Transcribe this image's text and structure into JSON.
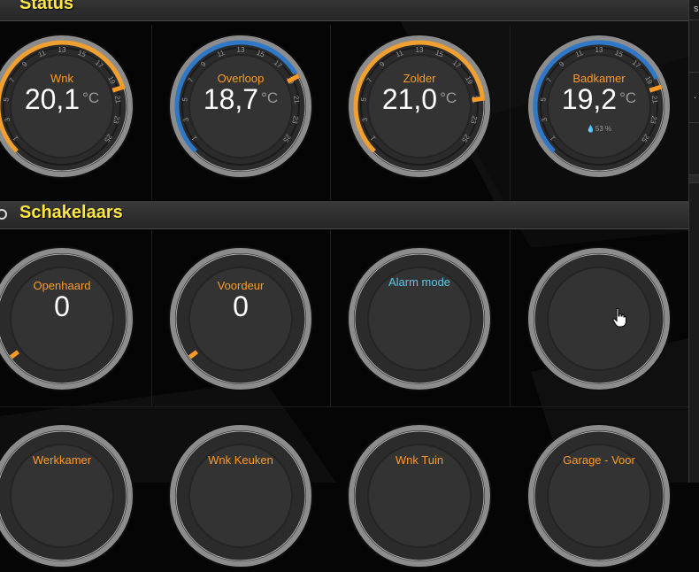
{
  "sections": {
    "status": {
      "title": "Status"
    },
    "switches": {
      "title": "Schakelaars"
    }
  },
  "thermostats": [
    {
      "label": "Wnk",
      "value": "20,1",
      "unit": "°C",
      "accent": "#f0a030",
      "setpoint": 20,
      "humidity": ""
    },
    {
      "label": "Overloop",
      "value": "18,7",
      "unit": "°C",
      "accent": "#2f78c8",
      "setpoint": 19,
      "humidity": ""
    },
    {
      "label": "Zolder",
      "value": "21,0",
      "unit": "°C",
      "accent": "#f0a030",
      "setpoint": 21,
      "humidity": ""
    },
    {
      "label": "Badkamer",
      "value": "19,2",
      "unit": "°C",
      "accent": "#2f78c8",
      "setpoint": 20,
      "humidity": "53 %"
    }
  ],
  "scale_ticks": [
    "1",
    "3",
    "5",
    "7",
    "9",
    "11",
    "13",
    "15",
    "17",
    "19",
    "21",
    "23",
    "25"
  ],
  "switches": [
    {
      "label": "Openhaard",
      "value": "0"
    },
    {
      "label": "Voordeur",
      "value": "0"
    },
    {
      "label": "Alarm mode",
      "value": ""
    },
    {
      "label": "",
      "value": ""
    }
  ],
  "bottom_row": [
    {
      "label": "Werkkamer"
    },
    {
      "label": "Wnk Keuken"
    },
    {
      "label": "Wnk Tuin"
    },
    {
      "label": "Garage - Voor"
    }
  ],
  "right_panel": {
    "chars": [
      "s",
      "",
      ".",
      "",
      ""
    ]
  },
  "colors": {
    "title": "#ffe740",
    "label": "#ff9a24",
    "marker": "#ff9a24"
  },
  "icons": {
    "humidity": "droplet-icon",
    "cursor": "hand-pointer-icon"
  }
}
